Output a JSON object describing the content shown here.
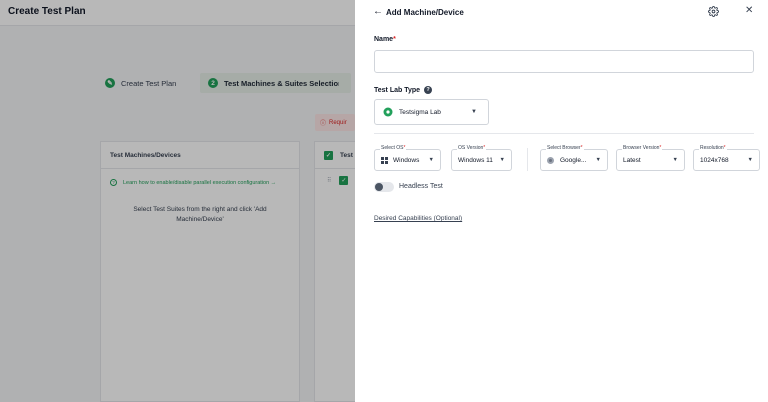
{
  "background": {
    "page_title": "Create Test Plan",
    "steps": [
      {
        "label": "Create Test Plan"
      },
      {
        "number": "2",
        "label": "Test Machines & Suites Selection"
      }
    ],
    "required_badge": "Requir",
    "machines_panel": {
      "header": "Test Machines/Devices",
      "learn_link": "Learn how to enable/disable parallel execution configuration →",
      "hint": "Select Test Suites from the right and click 'Add Machine/Device'"
    },
    "suites_panel": {
      "header": "Test"
    }
  },
  "drawer": {
    "title": "Add Machine/Device",
    "back_icon": "arrow-left-icon",
    "settings_icon": "gear-icon",
    "close_icon": "close-icon",
    "name_label": "Name",
    "name_value": "",
    "test_lab_label": "Test Lab Type",
    "test_lab_value": "Testsigma Lab",
    "fields": {
      "os": {
        "label": "Select OS",
        "value": "Windows"
      },
      "os_version": {
        "label": "OS Version",
        "value": "Windows 11"
      },
      "browser": {
        "label": "Select Browser",
        "value": "Google..."
      },
      "browser_version": {
        "label": "Browser Version",
        "value": "Latest"
      },
      "resolution": {
        "label": "Resolution",
        "value": "1024x768"
      }
    },
    "headless_label": "Headless Test",
    "headless_on": false,
    "capabilities_link": "Desired Capabilities (Optional)"
  },
  "colors": {
    "accent": "#22a05b",
    "required": "#dc2626",
    "overlay": "rgba(0,0,0,0.28)"
  }
}
